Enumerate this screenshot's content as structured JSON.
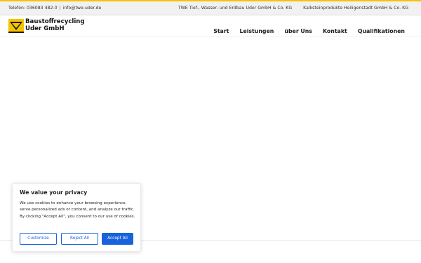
{
  "colors": {
    "accent": "#f5c400",
    "button_primary": "#1863dc",
    "topbar_bg": "#f1f1f1"
  },
  "topbar": {
    "phone": "Telefon: 036083 482-0",
    "separator": "|",
    "email": "info@twe-uder.de",
    "links": [
      "TWE Tief-, Wasser- und Erdbau Uder GmbH & Co. KG",
      "Kalksteinprodukte Heiligenstadt GmbH & Co. KG"
    ]
  },
  "header": {
    "logo_line1": "Baustoffrecycling",
    "logo_line2": "Uder GmbH",
    "logo_icon": "company-logo-icon",
    "nav": [
      "Start",
      "Leistungen",
      "über Uns",
      "Kontakt",
      "Qualifikationen"
    ]
  },
  "cookie_banner": {
    "title": "We value your privacy",
    "text": "We use cookies to enhance your browsing experience, serve personalized ads or content, and analyze our traffic. By clicking \"Accept All\", you consent to our use of cookies.",
    "customize_label": "Customize",
    "reject_label": "Reject All",
    "accept_label": "Accept All"
  }
}
